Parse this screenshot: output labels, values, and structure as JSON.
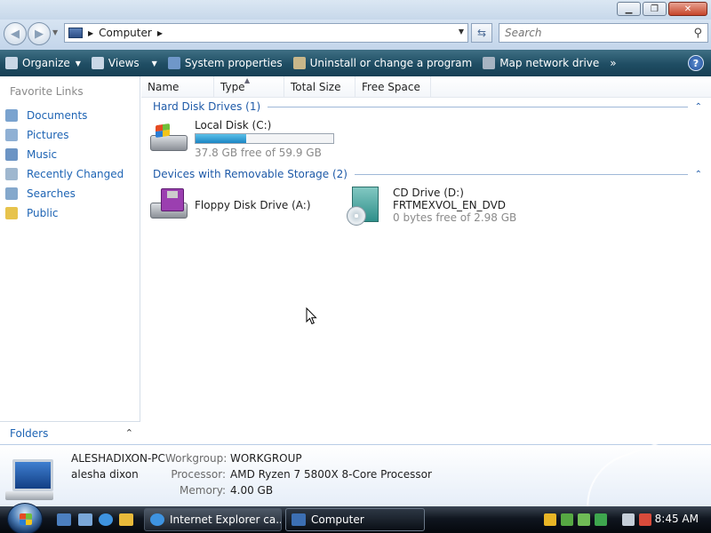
{
  "window": {
    "title_buttons": [
      "minimize",
      "maximize",
      "close"
    ]
  },
  "address": {
    "location": "Computer",
    "search_placeholder": "Search"
  },
  "toolbar": {
    "items": [
      "Organize",
      "Views",
      "System properties",
      "Uninstall or change a program",
      "Map network drive"
    ],
    "overflow": "»",
    "help": "?"
  },
  "navpane": {
    "header": "Favorite Links",
    "links": [
      "Documents",
      "Pictures",
      "Music",
      "Recently Changed",
      "Searches",
      "Public"
    ],
    "folders_label": "Folders"
  },
  "columns": [
    "Name",
    "Type",
    "Total Size",
    "Free Space"
  ],
  "groups": {
    "hard_disk": {
      "title": "Hard Disk Drives (1)",
      "drives": [
        {
          "name": "Local Disk (C:)",
          "free_text": "37.8 GB free of 59.9 GB",
          "used_fraction": 0.37
        }
      ]
    },
    "removable": {
      "title": "Devices with Removable Storage (2)",
      "drives": [
        {
          "name": "Floppy Disk Drive (A:)"
        },
        {
          "name": "CD Drive (D:)",
          "label": "FRTMEXVOL_EN_DVD",
          "free_text": "0 bytes free of 2.98 GB"
        }
      ]
    }
  },
  "details": {
    "computer_name": "ALESHADIXON-PC",
    "user": "alesha dixon",
    "workgroup_label": "Workgroup:",
    "workgroup": "WORKGROUP",
    "processor_label": "Processor:",
    "processor": "AMD Ryzen 7 5800X 8-Core Processor",
    "memory_label": "Memory:",
    "memory": "4.00 GB"
  },
  "taskbar": {
    "tasks": [
      "Internet Explorer ca...",
      "Computer"
    ],
    "clock": "8:45 AM"
  },
  "colors": {
    "toolbar": "#1f4d63",
    "link_blue": "#1e64b4",
    "group_blue": "#1e5aa8",
    "capacity_fill": "#1b86c4"
  }
}
